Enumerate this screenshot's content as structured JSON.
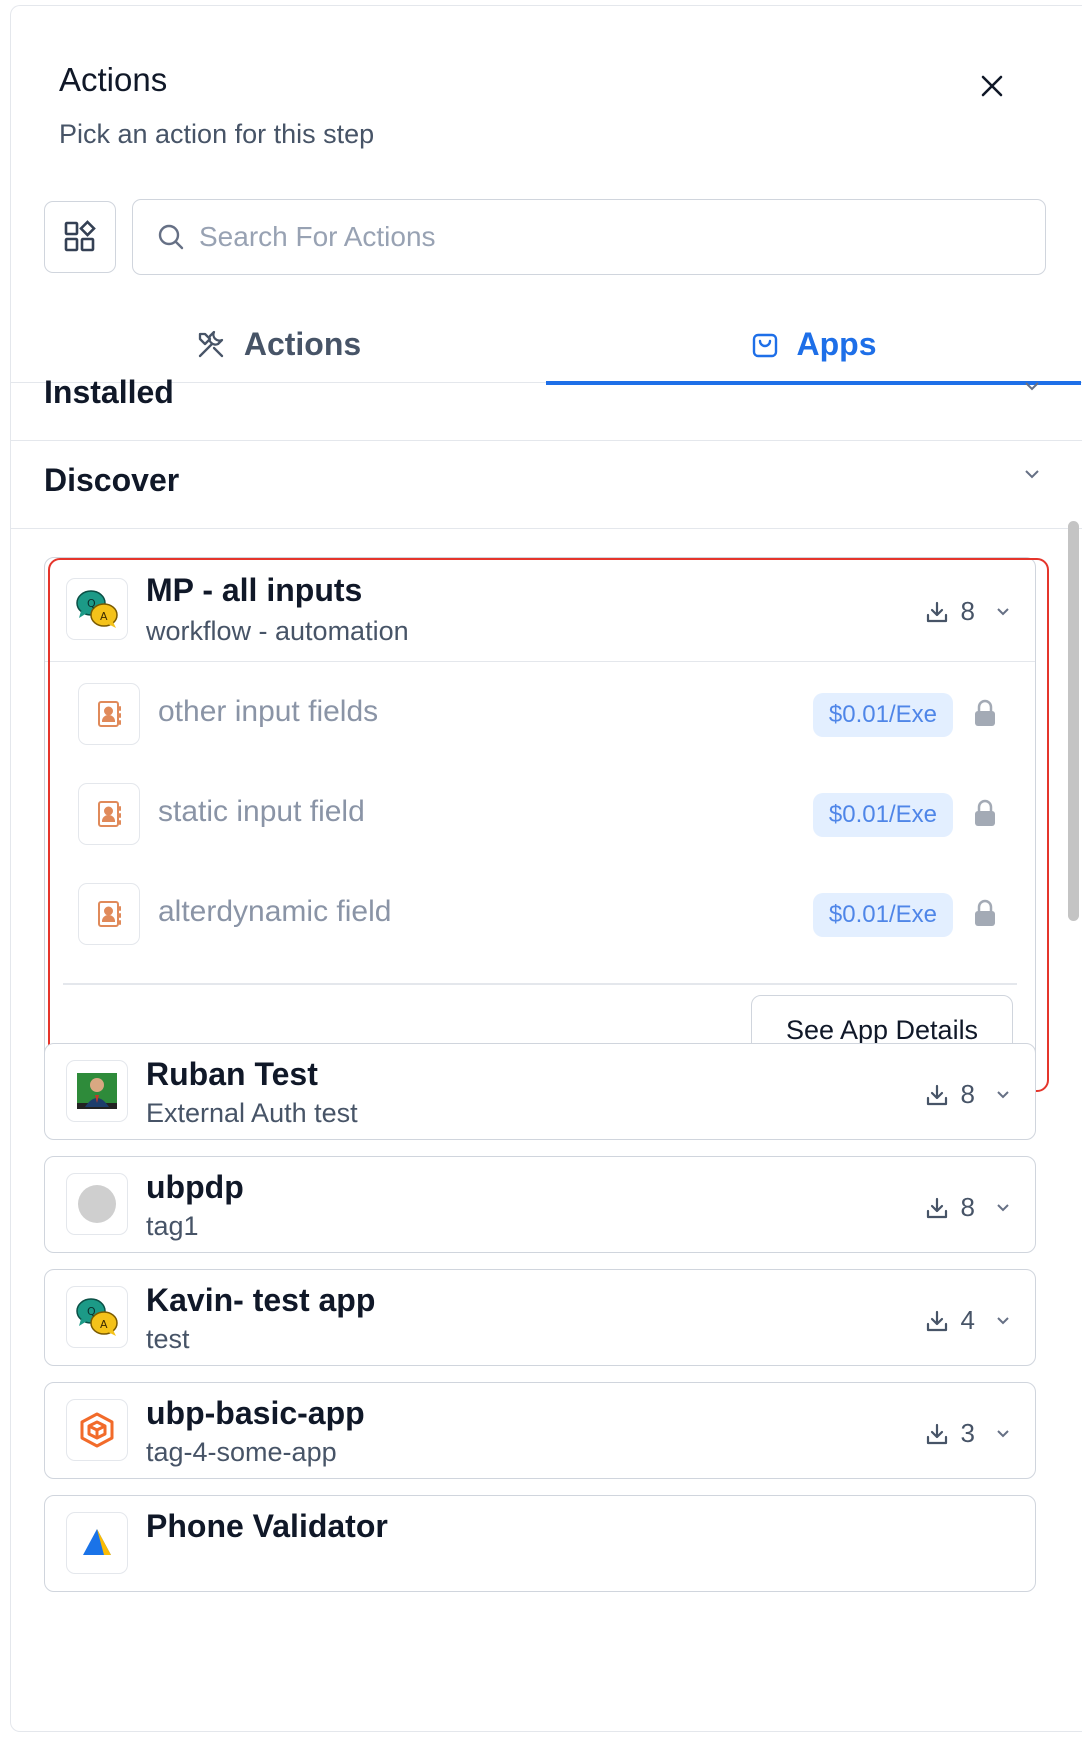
{
  "header": {
    "title": "Actions",
    "subtitle": "Pick an action for this step"
  },
  "search": {
    "placeholder": "Search For Actions",
    "value": ""
  },
  "tabs": [
    {
      "label": "Actions",
      "icon": "tools-icon",
      "active": false
    },
    {
      "label": "Apps",
      "icon": "bag-icon",
      "active": true
    }
  ],
  "sections": [
    {
      "label": "Installed"
    },
    {
      "label": "Discover"
    }
  ],
  "colors": {
    "accent": "#1e6fe8",
    "highlight_border": "#e5352b",
    "price_bg": "#e3efff",
    "price_text": "#4f86e8"
  },
  "apps": [
    {
      "name": "MP - all inputs",
      "tag": "workflow - automation",
      "installs": "8",
      "logo": "qa-chat-logo",
      "expanded": true,
      "actions": [
        {
          "name": "other input fields",
          "price": "$0.01/Exe",
          "icon": "contact-book-icon"
        },
        {
          "name": "static input field",
          "price": "$0.01/Exe",
          "icon": "contact-book-icon"
        },
        {
          "name": "alterdynamic field",
          "price": "$0.01/Exe",
          "icon": "contact-book-icon"
        }
      ],
      "details_label": "See App Details"
    },
    {
      "name": "Ruban Test",
      "tag": "External Auth test",
      "installs": "8",
      "logo": "person-photo-logo"
    },
    {
      "name": "ubpdp",
      "tag": "tag1",
      "installs": "8",
      "logo": "placeholder-logo"
    },
    {
      "name": "Kavin- test app",
      "tag": "test",
      "installs": "4",
      "logo": "qa-chat-logo"
    },
    {
      "name": "ubp-basic-app",
      "tag": "tag-4-some-app",
      "installs": "3",
      "logo": "cube-logo"
    },
    {
      "name": "Phone Validator",
      "tag": "",
      "installs": "",
      "logo": "triangle-logo"
    }
  ]
}
